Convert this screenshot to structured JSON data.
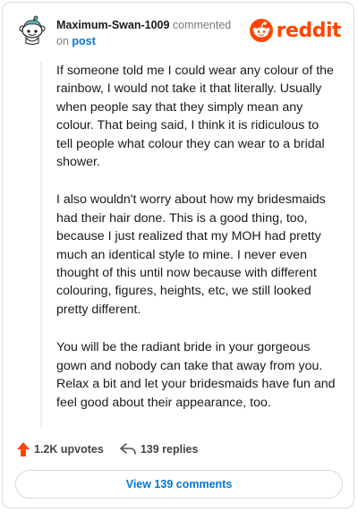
{
  "header": {
    "username": "Maximum-Swan-1009",
    "commented_text": "commented",
    "on_text": "on",
    "post_text": "post",
    "logo_text": "reddit"
  },
  "comment": {
    "paragraphs": [
      "If someone told me I could wear any colour of the rainbow, I would not take it that literally. Usually when people say that they simply mean any colour. That being said, I think it is ridiculous to tell people what colour they can wear to a bridal shower.",
      "I also wouldn't worry about how my bridesmaids had their hair done. This is a good thing, too, because I just realized that my MOH had pretty much an identical style to mine. I never even thought of this until now because with different colouring, figures, heights, etc, we still looked pretty different.",
      "You will be the radiant bride in your gorgeous gown and nobody can take that away from you. Relax a bit and let your bridesmaids have fun and feel good about their appearance, too."
    ]
  },
  "actions": {
    "upvotes": "1.2K upvotes",
    "replies": "139 replies",
    "view_comments": "View 139 comments"
  },
  "icons": {
    "avatar": "snoo-avatar-icon",
    "logo": "reddit-logo-icon",
    "upvote": "upvote-arrow-icon",
    "reply": "reply-arrow-icon"
  },
  "colors": {
    "brand": "#ff4500",
    "link": "#0079d3",
    "avatar_accent": "#4fbdba"
  }
}
